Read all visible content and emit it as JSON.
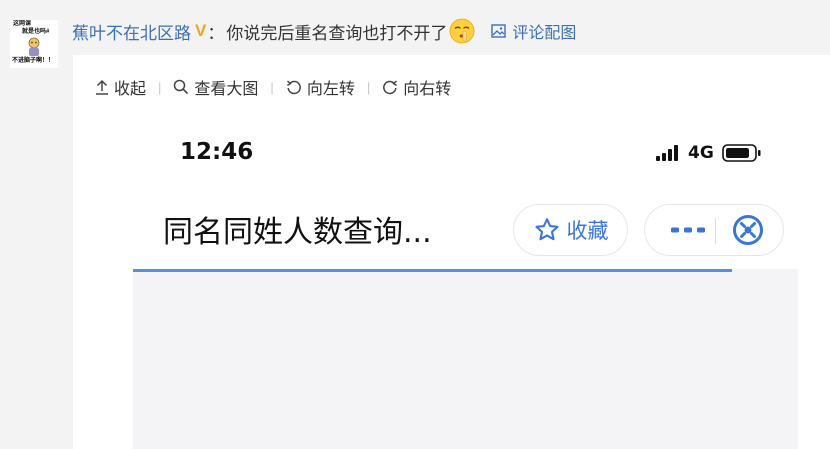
{
  "comment": {
    "avatar_lines": [
      "这网课",
      "就是也吗#",
      "不进脑子啊！！"
    ],
    "username": "蕉叶不在北区路",
    "vip_label": "V",
    "colon": "：",
    "text": "你说完后重名查询也打不开了",
    "emoji": "shushing-face-emoji",
    "pic_link_label": "评论配图"
  },
  "toolbar": {
    "collapse_label": "收起",
    "view_large_label": "查看大图",
    "rotate_left_label": "向左转",
    "rotate_right_label": "向右转",
    "separator": "|"
  },
  "screenshot": {
    "time": "12:46",
    "network": "4G",
    "page_title": "同名同姓人数查询...",
    "favorite_label": "收藏",
    "load_progress": 0.9
  },
  "colors": {
    "link": "#3b6fb6",
    "vip": "#f0a61a",
    "accent": "#3a76d8",
    "progress": "#4a93e8",
    "page_bg": "#f3f3f3"
  }
}
